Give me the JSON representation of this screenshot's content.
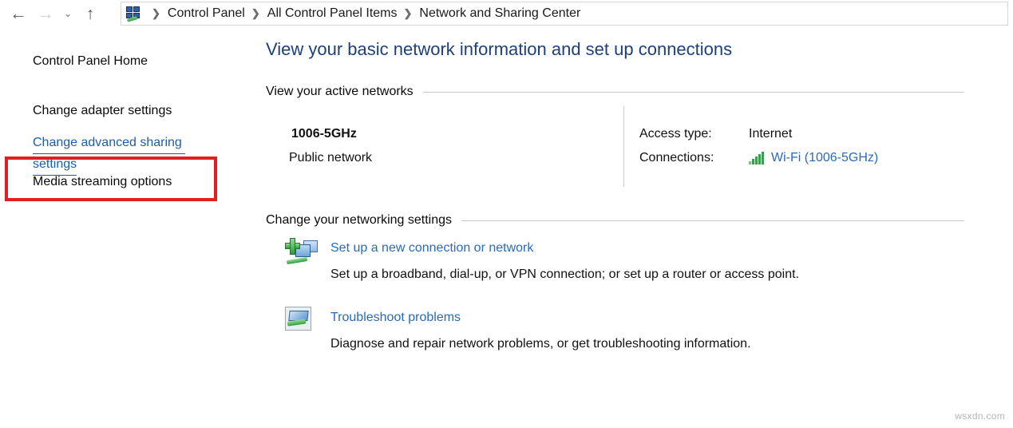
{
  "addressbar": {
    "nav": {
      "back_icon": "arrow-left-icon",
      "forward_icon": "arrow-right-icon",
      "recent_icon": "chevron-down-icon",
      "up_icon": "arrow-up-icon",
      "back_glyph": "←",
      "forward_glyph": "→",
      "recent_glyph": "⌄",
      "up_glyph": "↑"
    },
    "breadcrumb": {
      "icon": "network-sharing-center-icon",
      "separator": "❯",
      "items": [
        {
          "label": "Control Panel"
        },
        {
          "label": "All Control Panel Items"
        },
        {
          "label": "Network and Sharing Center"
        }
      ]
    }
  },
  "sidebar": {
    "items": [
      {
        "label": "Control Panel Home",
        "state": "normal"
      },
      {
        "label": "Change adapter settings",
        "state": "normal"
      },
      {
        "label": "Change advanced sharing settings",
        "state": "highlighted"
      },
      {
        "label": "Media streaming options",
        "state": "normal"
      }
    ],
    "highlighted_line1": "Change advanced sharing ",
    "highlighted_line2": "settings",
    "annotation_color": "#e02020"
  },
  "main": {
    "title": "View your basic network information and set up connections",
    "sections": {
      "active_networks": {
        "heading": "View your active networks",
        "network": {
          "name": "1006-5GHz",
          "type": "Public network"
        },
        "details": [
          {
            "label": "Access type:",
            "value": "Internet",
            "is_link": false,
            "icon": ""
          },
          {
            "label": "Connections:",
            "value": "Wi-Fi (1006-5GHz)",
            "is_link": true,
            "icon": "wifi-signal-icon"
          }
        ]
      },
      "networking_settings": {
        "heading": "Change your networking settings",
        "tasks": [
          {
            "icon": "new-connection-icon",
            "link": "Set up a new connection or network",
            "description": "Set up a broadband, dial-up, or VPN connection; or set up a router or access point."
          },
          {
            "icon": "troubleshoot-icon",
            "link": "Troubleshoot problems",
            "description": "Diagnose and repair network problems, or get troubleshooting information."
          }
        ]
      }
    }
  },
  "watermark": {
    "text": "wsxdn.com"
  },
  "colors": {
    "title": "#1f3f77",
    "link": "#2a6bb5",
    "highlight_link": "#1d5ea8",
    "annotation": "#e02020",
    "rule": "#c8c8c8",
    "signal_green": "#3f9b54"
  }
}
